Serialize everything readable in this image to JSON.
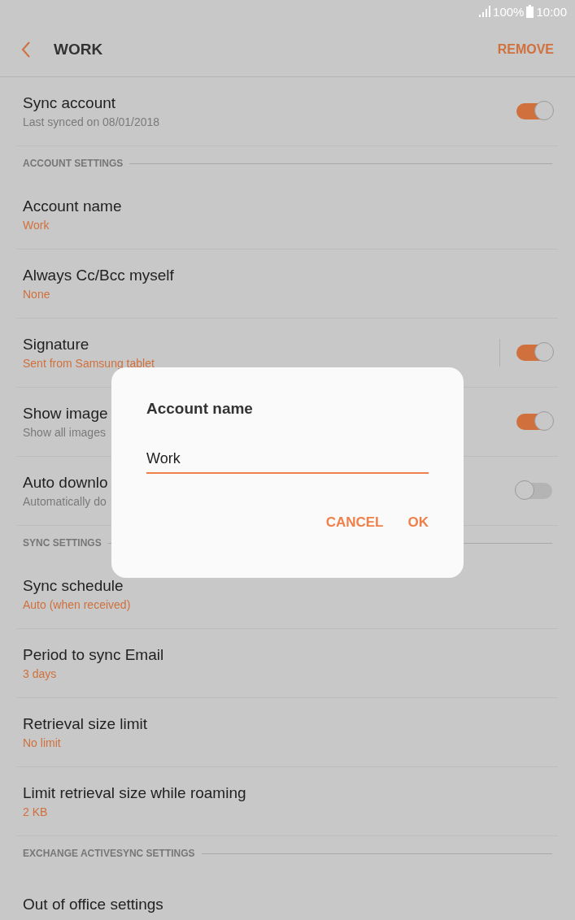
{
  "status_bar": {
    "battery": "100%",
    "time": "10:00"
  },
  "header": {
    "title": "WORK",
    "action": "REMOVE"
  },
  "sections": [
    {
      "items": [
        {
          "kind": "toggle",
          "title": "Sync account",
          "subtitle": "Last synced on 08/01/2018",
          "subtitle_accent": false,
          "on": true,
          "divider": false
        }
      ]
    },
    {
      "heading": "ACCOUNT SETTINGS",
      "items": [
        {
          "kind": "value",
          "title": "Account name",
          "subtitle": "Work",
          "subtitle_accent": true
        },
        {
          "kind": "value",
          "title": "Always Cc/Bcc myself",
          "subtitle": "None",
          "subtitle_accent": true
        },
        {
          "kind": "toggle",
          "title": "Signature",
          "subtitle": "Sent from Samsung tablet",
          "subtitle_accent": true,
          "on": true,
          "divider": true
        },
        {
          "kind": "toggle",
          "title": "Show image",
          "subtitle": "Show all images",
          "subtitle_accent": false,
          "on": true,
          "divider": false
        },
        {
          "kind": "toggle",
          "title": "Auto downlo",
          "subtitle": "Automatically do",
          "subtitle_accent": false,
          "on": false,
          "divider": false
        }
      ]
    },
    {
      "heading": "SYNC SETTINGS",
      "items": [
        {
          "kind": "value",
          "title": "Sync schedule",
          "subtitle": "Auto (when received)",
          "subtitle_accent": true
        },
        {
          "kind": "value",
          "title": "Period to sync Email",
          "subtitle": "3 days",
          "subtitle_accent": true
        },
        {
          "kind": "value",
          "title": "Retrieval size limit",
          "subtitle": "No limit",
          "subtitle_accent": true
        },
        {
          "kind": "value",
          "title": "Limit retrieval size while roaming",
          "subtitle": "2 KB",
          "subtitle_accent": true
        }
      ]
    },
    {
      "heading": "EXCHANGE ACTIVESYNC SETTINGS",
      "items": [
        {
          "kind": "value",
          "title": "Out of office settings"
        }
      ]
    }
  ],
  "dialog": {
    "title": "Account name",
    "value": "Work",
    "buttons": [
      "CANCEL",
      "OK"
    ]
  }
}
